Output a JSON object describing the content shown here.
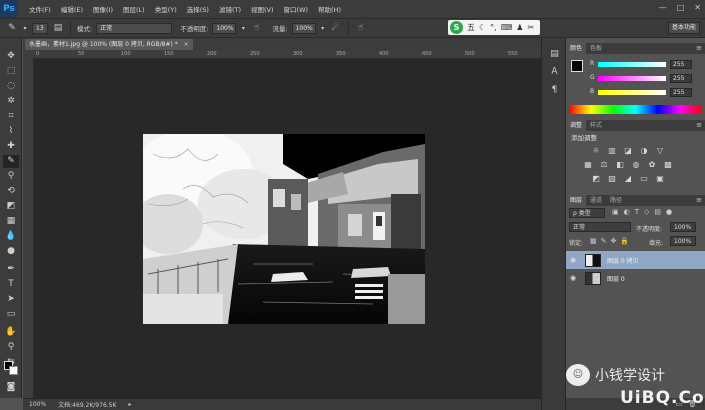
{
  "menubar": {
    "logo": "Ps",
    "items": [
      "文件(F)",
      "编辑(E)",
      "图像(I)",
      "图层(L)",
      "类型(Y)",
      "选择(S)",
      "滤镜(T)",
      "视图(V)",
      "窗口(W)",
      "帮助(H)"
    ],
    "window_controls": [
      "—",
      "□",
      "✕"
    ]
  },
  "options": {
    "brush_size": "13",
    "mode_label": "模式:",
    "mode_value": "正常",
    "opacity_label": "不透明度:",
    "opacity_value": "100%",
    "flow_label": "流量:",
    "flow_value": "100%",
    "workspace": "基本功能",
    "ime_label": "五"
  },
  "document": {
    "tab_title": "水墨画，素材1.jpg @ 100% (图层 0 拷贝, RGB/8#) *",
    "zoom": "100%",
    "doc_size": "文档:469.2K/976.5K"
  },
  "ruler_labels": [
    "0",
    "50",
    "100",
    "150",
    "200",
    "250",
    "300",
    "350",
    "400",
    "450",
    "500",
    "550"
  ],
  "color_panel": {
    "tabs": [
      "颜色",
      "色板"
    ],
    "sliders": [
      {
        "label": "R",
        "value": "255"
      },
      {
        "label": "G",
        "value": "255"
      },
      {
        "label": "B",
        "value": "255"
      }
    ]
  },
  "adjust_panel": {
    "tabs": [
      "调整",
      "样式"
    ],
    "title": "添加调整"
  },
  "layers_panel": {
    "tabs": [
      "图层",
      "通道",
      "路径"
    ],
    "filter_type": "ρ 类型",
    "blend_mode": "正常",
    "opacity_label": "不透明度:",
    "opacity_value": "100%",
    "lock_label": "锁定:",
    "fill_label": "填充:",
    "fill_value": "100%",
    "layers": [
      {
        "name": "图层 0 拷贝",
        "selected": true
      },
      {
        "name": "图层 0",
        "selected": false
      }
    ]
  },
  "watermarks": {
    "cn_text": "小钱学设计",
    "uibq": "UiBQ.CoM"
  },
  "colors": {
    "menubar_bg": "#3c3c3c",
    "canvas_bg": "#282828",
    "panel_bg": "#535353",
    "selected_layer": "#8fa6c4"
  }
}
